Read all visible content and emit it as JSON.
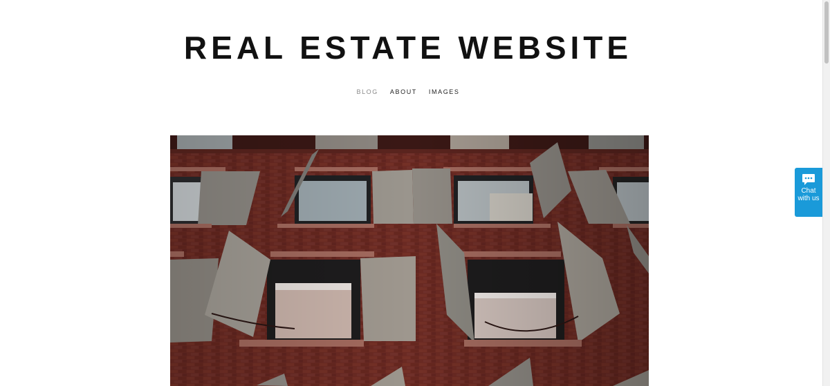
{
  "header": {
    "title": "REAL ESTATE WEBSITE"
  },
  "nav": {
    "items": [
      {
        "label": "BLOG",
        "active": true
      },
      {
        "label": "ABOUT",
        "active": false
      },
      {
        "label": "IMAGES",
        "active": false
      }
    ]
  },
  "hero": {
    "icon": "building-facade-photo"
  },
  "chat": {
    "label": "Chat with us",
    "icon": "chat-bubble-icon",
    "color": "#1a9ad9"
  },
  "colors": {
    "text": "#111111",
    "nav_active": "#8a8a8a",
    "brick": "#6a2822",
    "shutter": "#8e8a84"
  }
}
